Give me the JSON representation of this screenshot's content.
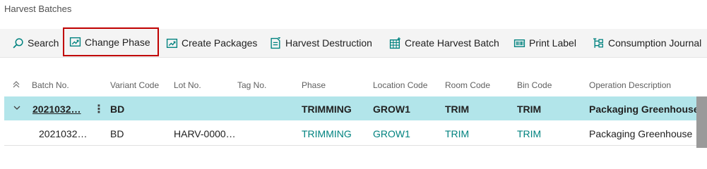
{
  "page": {
    "title": "Harvest Batches"
  },
  "toolbar": {
    "items": [
      {
        "label": "Search",
        "icon": "search-icon"
      },
      {
        "label": "Change Phase",
        "icon": "change-phase-icon",
        "active": true
      },
      {
        "label": "Create Packages",
        "icon": "create-packages-icon"
      },
      {
        "label": "Harvest Destruction",
        "icon": "harvest-destruction-icon"
      },
      {
        "label": "Create Harvest Batch",
        "icon": "create-harvest-batch-icon"
      },
      {
        "label": "Print Label",
        "icon": "print-label-icon"
      },
      {
        "label": "Consumption Journal",
        "icon": "consumption-journal-icon"
      }
    ]
  },
  "table": {
    "columns": [
      "Batch No.",
      "Variant Code",
      "Lot No.",
      "Tag No.",
      "Phase",
      "Location Code",
      "Room Code",
      "Bin Code",
      "Operation Description"
    ],
    "rows": [
      {
        "batch_no": "2021032…",
        "variant_code": "BD",
        "lot_no": "",
        "tag_no": "",
        "phase": "TRIMMING",
        "location_code": "GROW1",
        "room_code": "TRIM",
        "bin_code": "TRIM",
        "operation_description": "Packaging Greenhouse"
      },
      {
        "batch_no": "2021032…",
        "variant_code": "BD",
        "lot_no": "HARV-0000…",
        "tag_no": "",
        "phase": "TRIMMING",
        "location_code": "GROW1",
        "room_code": "TRIM",
        "bin_code": "TRIM",
        "operation_description": "Packaging Greenhouse"
      }
    ]
  },
  "colors": {
    "accent": "#00827f",
    "selected_row": "#b2e5ea",
    "highlight_border": "#c00000"
  }
}
